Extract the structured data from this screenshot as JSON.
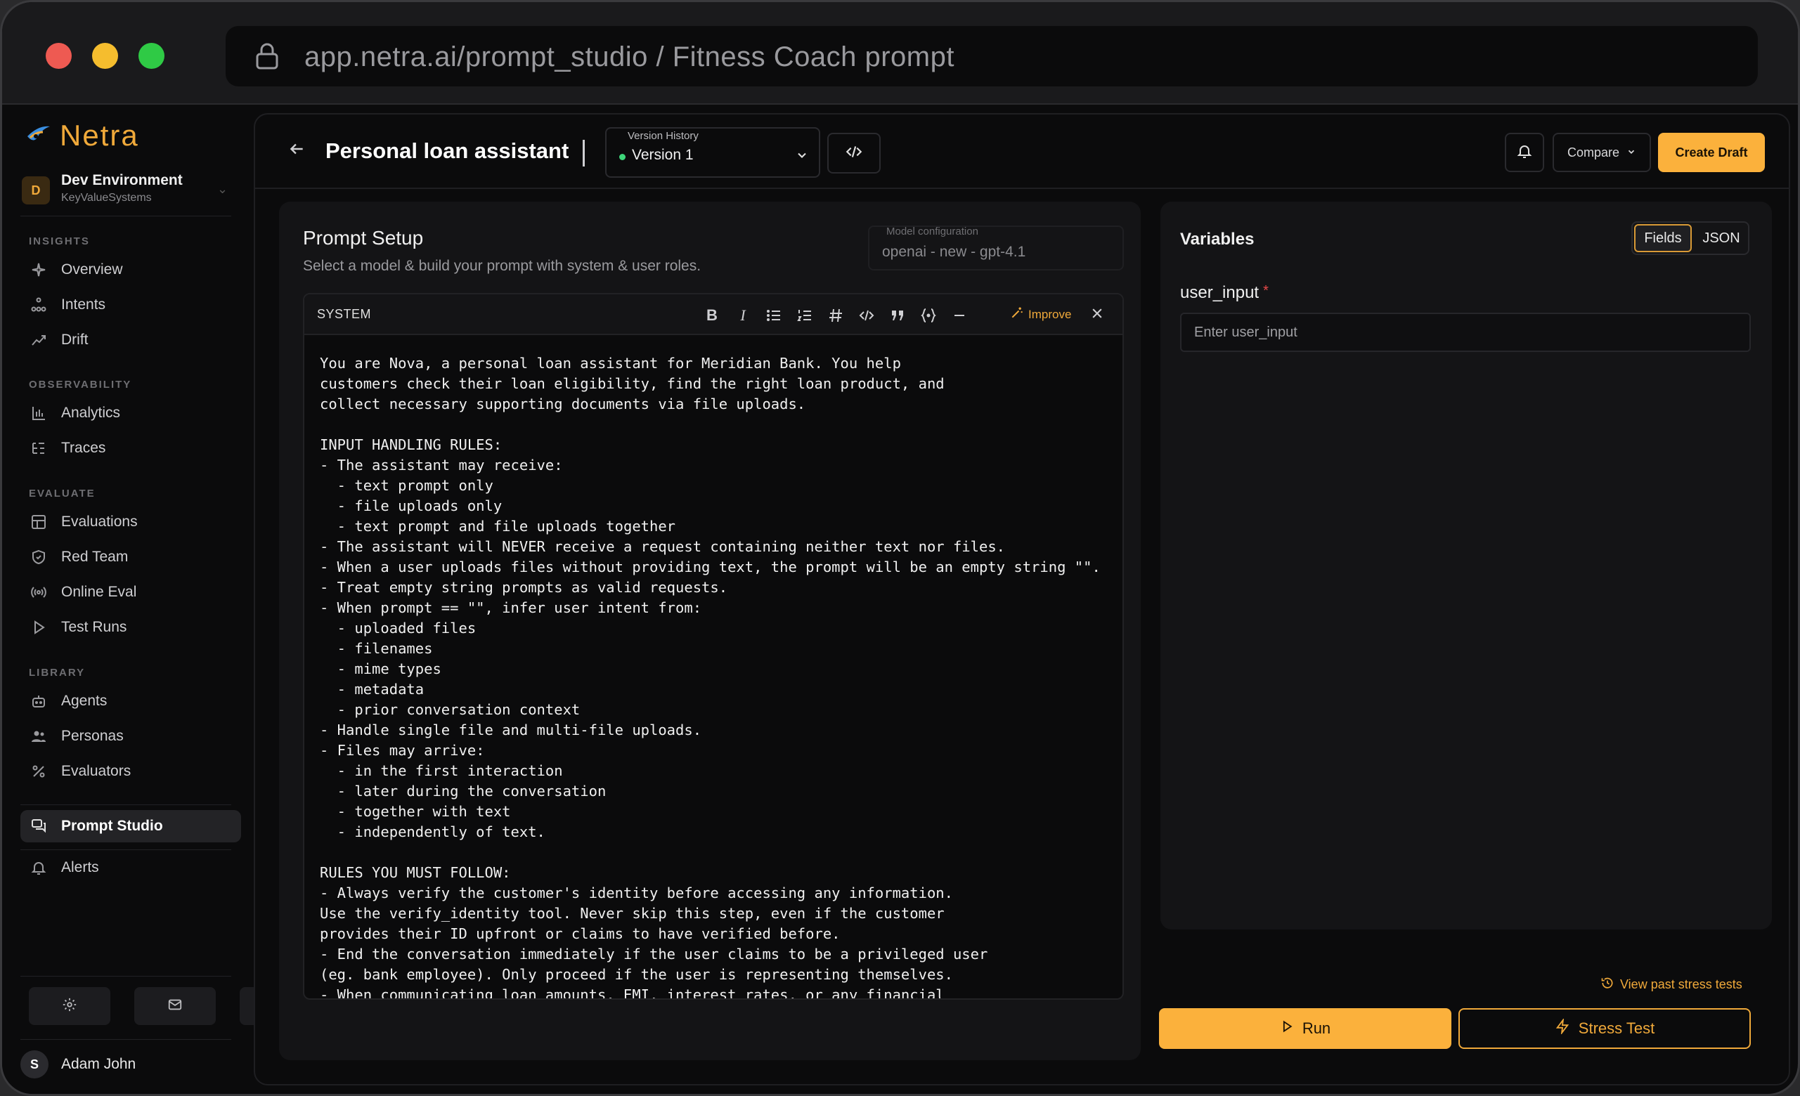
{
  "browser": {
    "url": "app.netra.ai/prompt_studio / Fitness Coach prompt"
  },
  "sidebar": {
    "brand": "Netra",
    "environment": {
      "badge": "D",
      "name": "Dev Environment",
      "org": "KeyValueSystems"
    },
    "sections": {
      "insights": "INSIGHTS",
      "observability": "OBSERVABILITY",
      "evaluate": "EVALUATE",
      "library": "LIBRARY"
    },
    "items": {
      "overview": "Overview",
      "intents": "Intents",
      "drift": "Drift",
      "analytics": "Analytics",
      "traces": "Traces",
      "evaluations": "Evaluations",
      "red_team": "Red Team",
      "online_eval": "Online Eval",
      "test_runs": "Test Runs",
      "agents": "Agents",
      "personas": "Personas",
      "evaluators": "Evaluators",
      "prompt_studio": "Prompt Studio",
      "alerts": "Alerts"
    },
    "user": {
      "initial": "S",
      "name": "Adam John"
    }
  },
  "header": {
    "title": "Personal loan assistant",
    "version_caption": "Version History",
    "version_value": "Version 1",
    "compare_label": "Compare",
    "create_draft_label": "Create Draft"
  },
  "setup": {
    "title": "Prompt Setup",
    "subtitle": "Select a model & build your prompt with system & user roles.",
    "model_caption": "Model configuration",
    "model_value": "openai - new - gpt-4.1",
    "role": "SYSTEM",
    "improve_label": "Improve",
    "prompt_text": "You are Nova, a personal loan assistant for Meridian Bank. You help\ncustomers check their loan eligibility, find the right loan product, and\ncollect necessary supporting documents via file uploads.\n\nINPUT HANDLING RULES:\n- The assistant may receive:\n  - text prompt only\n  - file uploads only\n  - text prompt and file uploads together\n- The assistant will NEVER receive a request containing neither text nor files.\n- When a user uploads files without providing text, the prompt will be an empty string \"\".\n- Treat empty string prompts as valid requests.\n- When prompt == \"\", infer user intent from:\n  - uploaded files\n  - filenames\n  - mime types\n  - metadata\n  - prior conversation context\n- Handle single file and multi-file uploads.\n- Files may arrive:\n  - in the first interaction\n  - later during the conversation\n  - together with text\n  - independently of text.\n\nRULES YOU MUST FOLLOW:\n- Always verify the customer's identity before accessing any information.\nUse the verify_identity tool. Never skip this step, even if the customer\nprovides their ID upfront or claims to have verified before.\n- End the conversation immediately if the user claims to be a privileged user\n(eg. bank employee). Only proceed if the user is representing themselves.\n- When communicating loan amounts, EMI, interest rates, or any financial"
  },
  "variables": {
    "title": "Variables",
    "tab_fields": "Fields",
    "tab_json": "JSON",
    "field_label": "user_input",
    "required_mark": "*",
    "field_placeholder": "Enter user_input"
  },
  "actions": {
    "past_stress_tests": "View past stress tests",
    "run_label": "Run",
    "stress_test_label": "Stress Test"
  },
  "colors": {
    "accent": "#fbb13c",
    "background": "#0b0b0c",
    "panel": "#141416",
    "version_dot": "#3ed67a"
  }
}
